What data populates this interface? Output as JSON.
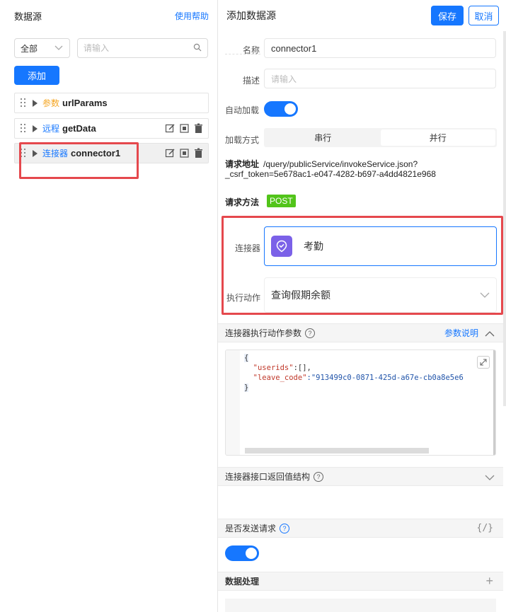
{
  "left": {
    "title": "数据源",
    "help_link": "使用帮助",
    "filter_select": "全部",
    "search_placeholder": "请输入",
    "add_button": "添加",
    "items": [
      {
        "type": "参数",
        "name": "urlParams",
        "type_color": "#f5a623"
      },
      {
        "type": "远程",
        "name": "getData",
        "type_color": "#1677ff"
      },
      {
        "type": "连接器",
        "name": "connector1",
        "type_color": "#1677ff"
      }
    ]
  },
  "right": {
    "title": "添加数据源",
    "save_button": "保存",
    "cancel_button": "取消",
    "name_label": "名称",
    "name_value": "connector1",
    "desc_label": "描述",
    "desc_placeholder": "请输入",
    "autoload_label": "自动加载",
    "autoload_on": true,
    "load_mode_label": "加载方式",
    "load_mode_options": [
      "串行",
      "并行"
    ],
    "load_mode_selected": "并行",
    "request_url_label": "请求地址",
    "request_url_value": "/query/publicService/invokeService.json?_csrf_token=5e678ac1-e047-4282-b697-a4dd4821e968",
    "request_method_label": "请求方法",
    "request_method_value": "POST",
    "connector_label": "连接器",
    "connector_value": "考勤",
    "action_label": "执行动作",
    "action_value": "查询假期余额",
    "params_section_title": "连接器执行动作参数",
    "params_help_link": "参数说明",
    "code_lines": {
      "open": "{",
      "line1_key": "\"userids\"",
      "line1_val": ":[],",
      "line2_key": "\"leave_code\"",
      "line2_val": ":\"913499c0-0871-425d-a67e-cb0a8e5e6",
      "close": "}"
    },
    "return_section_title": "连接器接口返回值结构",
    "send_request_label": "是否发送请求",
    "send_request_on": true,
    "json_icon_text": "{/}",
    "data_processing_label": "数据处理",
    "accent_color": "#1677ff",
    "highlight_color": "#e5484d"
  }
}
